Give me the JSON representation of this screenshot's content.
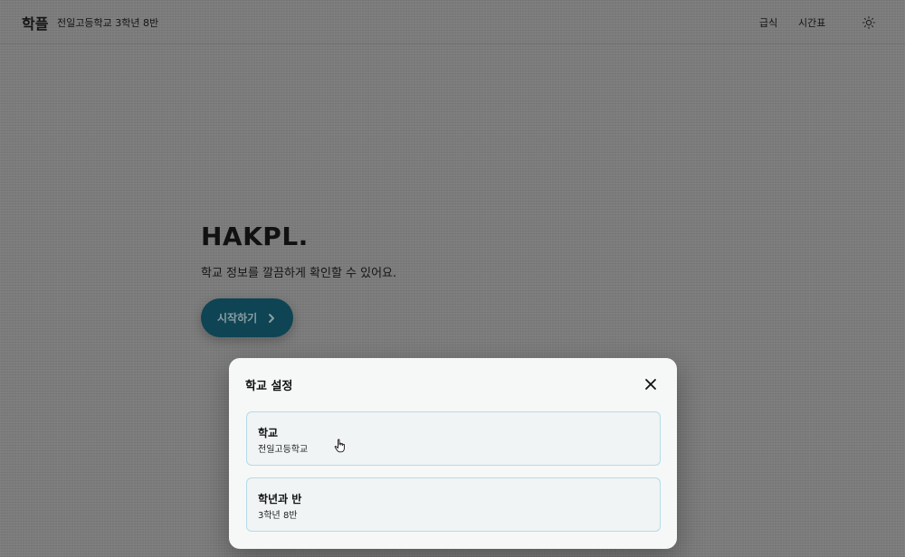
{
  "header": {
    "logo": "학플",
    "school": "전일고등학교 3학년 8반",
    "nav": {
      "meal": "급식",
      "timetable": "시간표"
    },
    "theme_icon": "sun-icon"
  },
  "hero": {
    "title": "HAKPL.",
    "subtitle": "학교 정보를 깔끔하게 확인할 수 있어요.",
    "start_label": "시작하기",
    "start_icon": "chevron-right-icon",
    "accent_color": "#0e4453"
  },
  "modal": {
    "title": "학교 설정",
    "close_icon": "close-icon",
    "cards": {
      "school": {
        "label": "학교",
        "value": "전일고등학교"
      },
      "grade_class": {
        "label": "학년과 반",
        "value": "3학년 8반"
      }
    },
    "card_border_color": "#b5dbe7"
  }
}
